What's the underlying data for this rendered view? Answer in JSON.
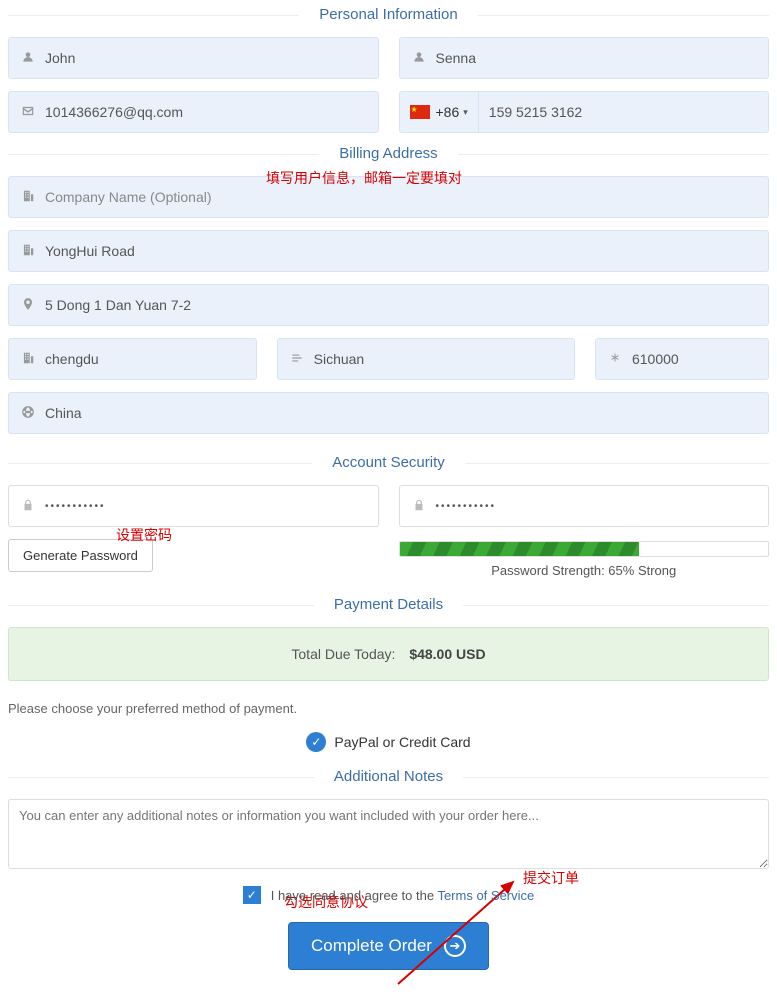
{
  "sections": {
    "personal": "Personal Information",
    "billing": "Billing Address",
    "security": "Account Security",
    "payment": "Payment Details",
    "notes": "Additional Notes"
  },
  "personal": {
    "first_name": "John",
    "last_name": "Senna",
    "email": "1014366276@qq.com",
    "phone_code": "+86",
    "phone_number": "159 5215 3162"
  },
  "billing": {
    "company_placeholder": "Company Name (Optional)",
    "street1": "YongHui Road",
    "street2": "5 Dong 1 Dan Yuan 7-2",
    "city": "chengdu",
    "state": "Sichuan",
    "zip": "610000",
    "country": "China"
  },
  "security": {
    "password_mask": "•••••••••••",
    "confirm_mask": "•••••••••••",
    "generate_btn": "Generate Password",
    "strength_text": "Password Strength: 65% Strong",
    "strength_percent": 65
  },
  "payment": {
    "total_label": "Total Due Today:",
    "total_amount": "$48.00 USD",
    "choose_text": "Please choose your preferred method of payment.",
    "option1": "PayPal or Credit Card"
  },
  "notes": {
    "placeholder": "You can enter any additional notes or information you want included with your order here..."
  },
  "tos": {
    "text_prefix": "I have read and agree to the ",
    "link_text": "Terms of Service"
  },
  "submit": {
    "label": "Complete Order"
  },
  "annotations": {
    "a1": "填写用户信息，邮箱一定要填对",
    "a2": "设置密码",
    "a3": "勾选同意协议",
    "a4": "提交订单"
  }
}
